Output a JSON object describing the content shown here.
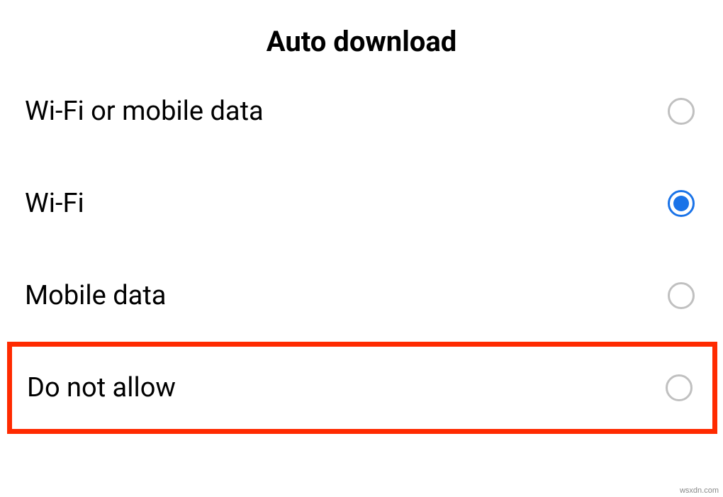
{
  "title": "Auto download",
  "options": [
    {
      "label": "Wi-Fi or mobile data",
      "selected": false,
      "highlighted": false,
      "name": "option-wifi-or-mobile"
    },
    {
      "label": "Wi-Fi",
      "selected": true,
      "highlighted": false,
      "name": "option-wifi"
    },
    {
      "label": "Mobile data",
      "selected": false,
      "highlighted": false,
      "name": "option-mobile-data"
    },
    {
      "label": "Do not allow",
      "selected": false,
      "highlighted": true,
      "name": "option-do-not-allow"
    }
  ],
  "watermark": "wsxdn.com"
}
